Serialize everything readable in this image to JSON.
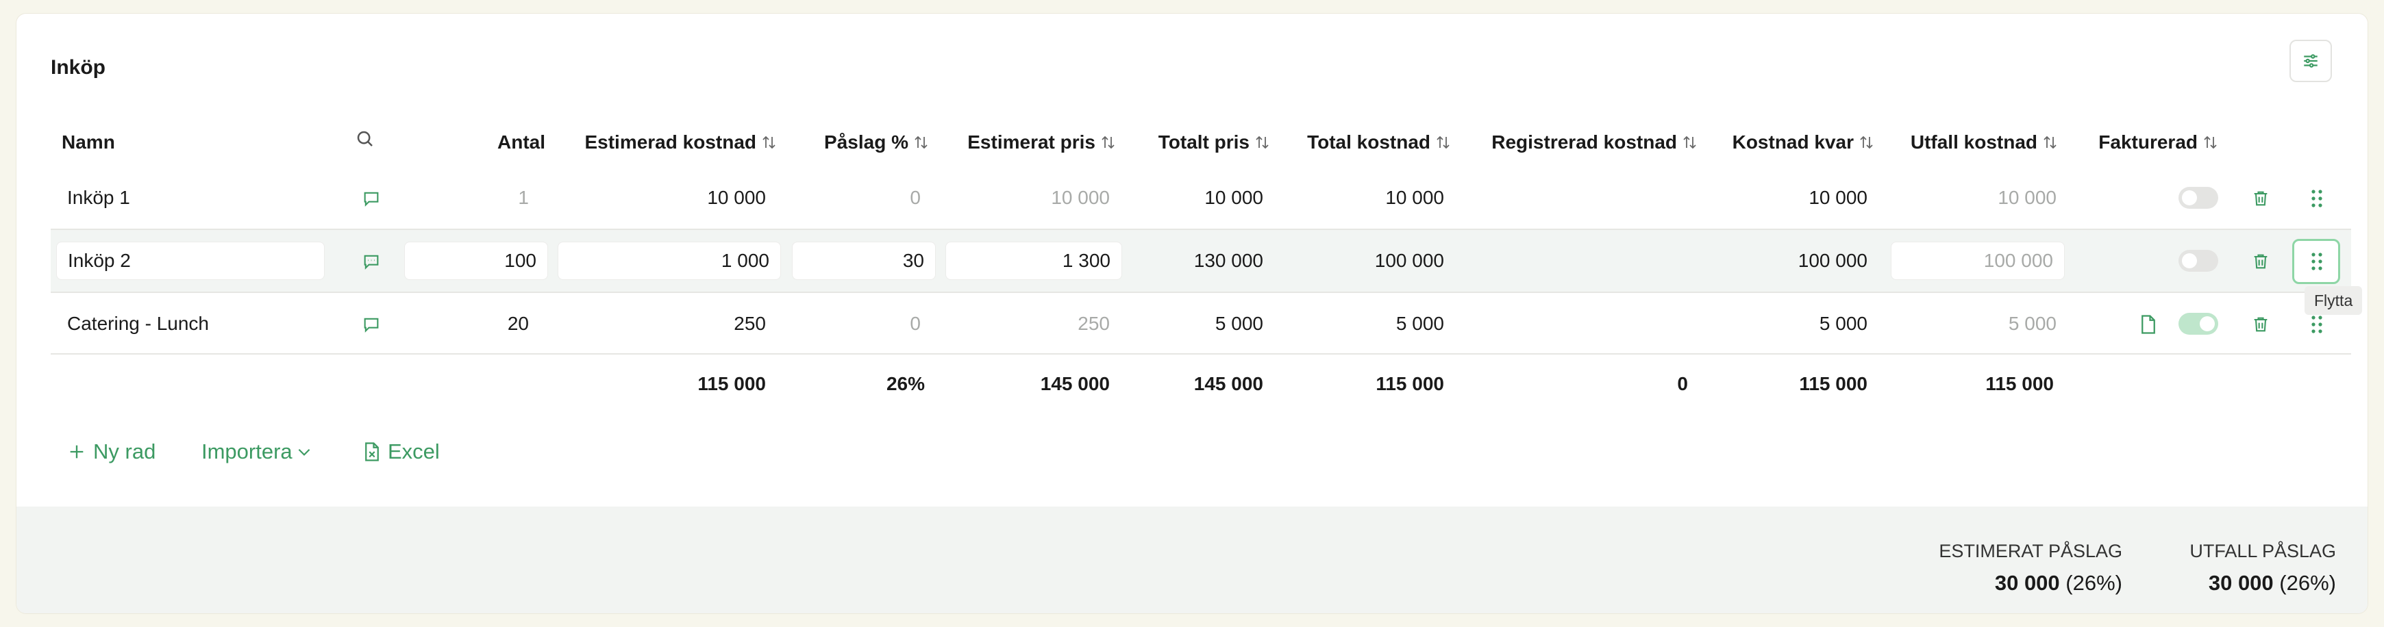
{
  "title": "Inköp",
  "columns": {
    "namn": "Namn",
    "antal": "Antal",
    "est_kostnad": "Estimerad kostnad",
    "paslag": "Påslag %",
    "est_pris": "Estimerat pris",
    "totalt_pris": "Totalt pris",
    "total_kostnad": "Total kostnad",
    "reg_kostnad": "Registrerad kostnad",
    "kostnad_kvar": "Kostnad kvar",
    "utfall_kostnad": "Utfall kostnad",
    "fakturerad": "Fakturerad"
  },
  "rows": [
    {
      "name": "Inköp 1",
      "antal": "1",
      "est_kostnad": "10 000",
      "paslag": "0",
      "est_pris": "10 000",
      "totalt_pris": "10 000",
      "total_kostnad": "10 000",
      "kostnad_kvar": "10 000",
      "utfall_kostnad": "10 000",
      "fakturerad": false
    },
    {
      "name": "Inköp 2",
      "antal": "100",
      "est_kostnad": "1 000",
      "paslag": "30",
      "est_pris": "1 300",
      "totalt_pris": "130 000",
      "total_kostnad": "100 000",
      "kostnad_kvar": "100 000",
      "utfall_kostnad": "100 000",
      "fakturerad": false
    },
    {
      "name": "Catering - Lunch",
      "antal": "20",
      "est_kostnad": "250",
      "paslag": "0",
      "est_pris": "250",
      "totalt_pris": "5 000",
      "total_kostnad": "5 000",
      "kostnad_kvar": "5 000",
      "utfall_kostnad": "5 000",
      "fakturerad": true
    }
  ],
  "totals": {
    "est_kostnad": "115 000",
    "paslag": "26%",
    "est_pris": "145 000",
    "totalt_pris": "145 000",
    "total_kostnad": "115 000",
    "reg_kostnad": "0",
    "kostnad_kvar": "115 000",
    "utfall_kostnad": "115 000"
  },
  "tooltip": "Flytta",
  "actions": {
    "new_row": "Ny rad",
    "import": "Importera",
    "excel": "Excel"
  },
  "footer": {
    "est_label": "ESTIMERAT PÅSLAG",
    "est_value": "30 000",
    "est_pct": "(26%)",
    "utfall_label": "UTFALL PÅSLAG",
    "utfall_value": "30 000",
    "utfall_pct": "(26%)"
  },
  "icons": {
    "settings": "sliders-icon",
    "search": "search-icon",
    "sort": "sort-arrows-icon",
    "comment": "comment-icon",
    "trash": "trash-icon",
    "drag": "drag-handle-icon",
    "document": "document-icon",
    "plus": "plus-icon",
    "chevron": "chevron-down-icon",
    "excel": "excel-file-icon"
  },
  "colors": {
    "accent": "#3c9a62",
    "muted": "#a8aaa8",
    "highlight_row": "#f2f5f3",
    "footer_bg": "#f2f4f2"
  }
}
